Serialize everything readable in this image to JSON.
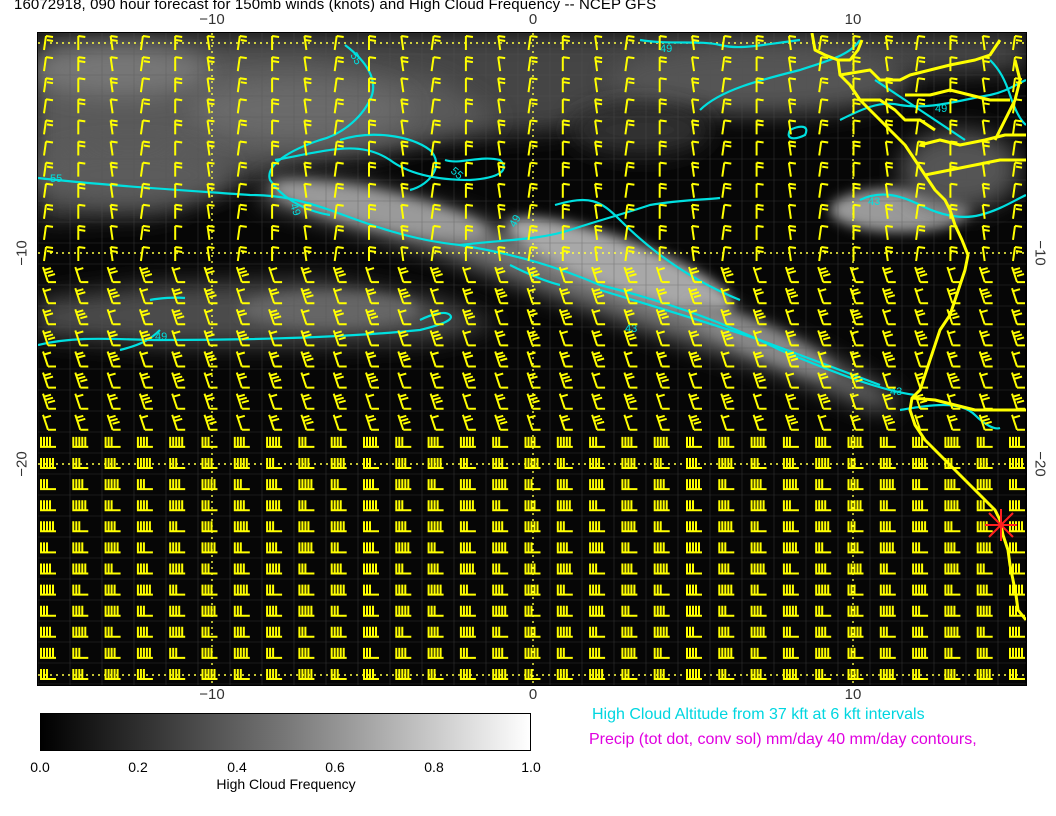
{
  "title": "16072918, 090 hour forecast for 150mb winds (knots) and High Cloud Frequency -- NCEP GFS",
  "axes": {
    "top_ticks": [
      "−10",
      "0",
      "10"
    ],
    "bottom_ticks": [
      "−10",
      "0",
      "10"
    ],
    "left_ticks": [
      "−10",
      "−20"
    ],
    "right_ticks": [
      "−10",
      "−20"
    ]
  },
  "contours": {
    "labels": [
      "55",
      "55",
      "55",
      "49",
      "49",
      "49",
      "49",
      "49",
      "43",
      "43",
      "43"
    ]
  },
  "colorbar": {
    "ticks": [
      "0.0",
      "0.2",
      "0.4",
      "0.6",
      "0.8",
      "1.0"
    ],
    "label": "High Cloud Frequency"
  },
  "legend": {
    "cyan_text": "High Cloud Altitude from 37 kft at 6 kft intervals",
    "magenta_text": "Precip (tot dot, conv sol) mm/day 40 mm/day contours,"
  },
  "colors": {
    "wind_barbs": "#ffff00",
    "coastline": "#ffff00",
    "contours": "#00e5e5",
    "grid": "#ffff66",
    "marker": "#ff2020",
    "legend_cyan": "#00d6e0",
    "legend_magenta": "#e000e0"
  },
  "icons": {
    "marker": "red-star-marker-icon"
  }
}
